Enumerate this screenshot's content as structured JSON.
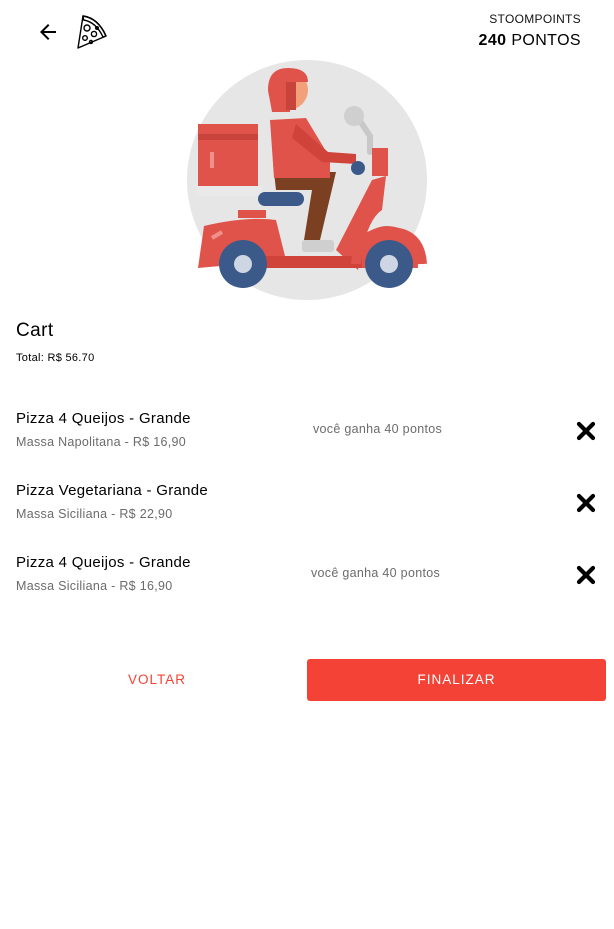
{
  "header": {
    "points_label": "STOOMPOINTS",
    "points_value": "240",
    "points_unit": "PONTOS"
  },
  "cart": {
    "title": "Cart",
    "total": "Total: R$ 56.70",
    "items": [
      {
        "name": "Pizza 4 Queijos - Grande",
        "sub": "Massa Napolitana - R$ 16,90",
        "earn": "você ganha 40 pontos"
      },
      {
        "name": "Pizza Vegetariana - Grande",
        "sub": "Massa Siciliana - R$ 22,90",
        "earn": ""
      },
      {
        "name": "Pizza 4 Queijos - Grande",
        "sub": "Massa Siciliana - R$ 16,90",
        "earn": "você ganha 40 pontos"
      }
    ]
  },
  "actions": {
    "back_label": "VOLTAR",
    "finish_label": "FINALIZAR"
  },
  "colors": {
    "accent": "#f44336",
    "hero_circle": "#e6e6e6",
    "scooter_red": "#e0534a",
    "wheel_blue": "#3b5a8a"
  },
  "icons": {
    "back": "arrow-left-icon",
    "logo": "pizza-slice-icon",
    "remove": "close-icon",
    "hero": "delivery-scooter-illustration"
  }
}
